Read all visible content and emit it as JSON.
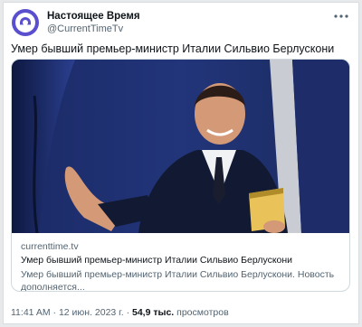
{
  "author": {
    "display_name": "Настоящее Время",
    "handle": "@CurrentTimeTv",
    "avatar_icon": "current-time-logo-icon"
  },
  "more_icon": "more-dots-icon",
  "tweet": {
    "text": "Умер бывший премьер-министр Италии Сильвио Берлускони"
  },
  "card": {
    "domain": "currenttime.tv",
    "title": "Умер бывший премьер-министр Италии Сильвио Берлускони",
    "description": "Умер бывший премьер-министр Италии Сильвио Берлускони. Новость дополняется..."
  },
  "footer": {
    "time": "11:41 AM",
    "date": "12 июн. 2023 г.",
    "views_count": "54,9 тыс.",
    "views_label": "просмотров"
  },
  "colors": {
    "brand": "#5a4fcf",
    "text_primary": "#0f1419",
    "text_secondary": "#536471",
    "border": "#cfd9de"
  }
}
